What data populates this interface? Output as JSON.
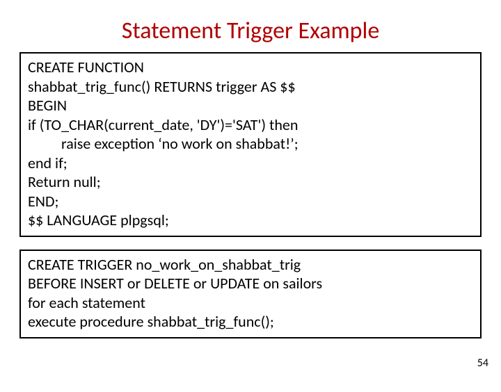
{
  "title": "Statement Trigger Example",
  "box1": {
    "l1": "CREATE FUNCTION",
    "l2": "shabbat_trig_func() RETURNS trigger AS $$",
    "l3": "BEGIN",
    "l4": "if (TO_CHAR(current_date, 'DY')='SAT') then",
    "l5": "raise exception ‘no work on shabbat!’;",
    "l6": "end if;",
    "l7": "Return null;",
    "l8": "END;",
    "l9": "$$ LANGUAGE plpgsql;"
  },
  "box2": {
    "l1": "CREATE TRIGGER no_work_on_shabbat_trig",
    "l2": "BEFORE INSERT or DELETE or UPDATE on sailors",
    "l3": "for each statement",
    "l4": "execute procedure shabbat_trig_func();"
  },
  "pagenum": "54"
}
